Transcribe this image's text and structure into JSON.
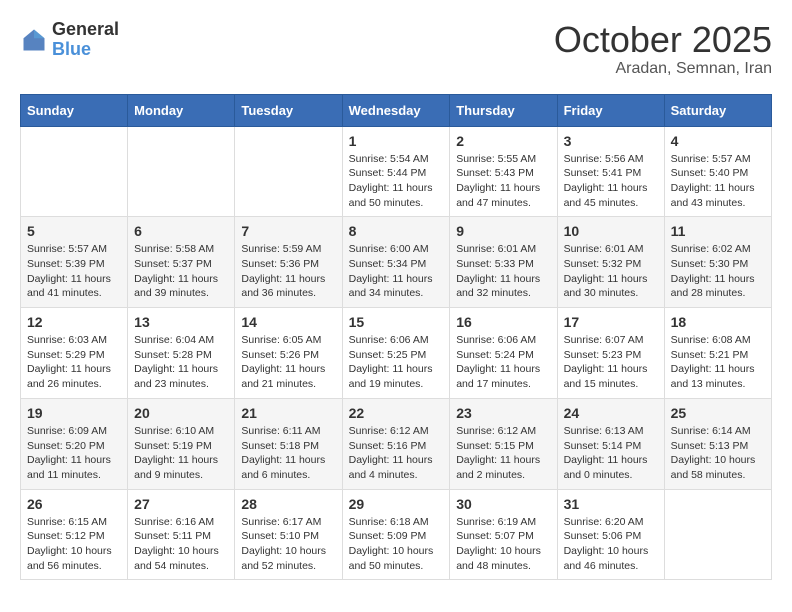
{
  "logo": {
    "general": "General",
    "blue": "Blue"
  },
  "header": {
    "month": "October 2025",
    "location": "Aradan, Semnan, Iran"
  },
  "weekdays": [
    "Sunday",
    "Monday",
    "Tuesday",
    "Wednesday",
    "Thursday",
    "Friday",
    "Saturday"
  ],
  "weeks": [
    [
      {
        "day": "",
        "info": ""
      },
      {
        "day": "",
        "info": ""
      },
      {
        "day": "",
        "info": ""
      },
      {
        "day": "1",
        "info": "Sunrise: 5:54 AM\nSunset: 5:44 PM\nDaylight: 11 hours\nand 50 minutes."
      },
      {
        "day": "2",
        "info": "Sunrise: 5:55 AM\nSunset: 5:43 PM\nDaylight: 11 hours\nand 47 minutes."
      },
      {
        "day": "3",
        "info": "Sunrise: 5:56 AM\nSunset: 5:41 PM\nDaylight: 11 hours\nand 45 minutes."
      },
      {
        "day": "4",
        "info": "Sunrise: 5:57 AM\nSunset: 5:40 PM\nDaylight: 11 hours\nand 43 minutes."
      }
    ],
    [
      {
        "day": "5",
        "info": "Sunrise: 5:57 AM\nSunset: 5:39 PM\nDaylight: 11 hours\nand 41 minutes."
      },
      {
        "day": "6",
        "info": "Sunrise: 5:58 AM\nSunset: 5:37 PM\nDaylight: 11 hours\nand 39 minutes."
      },
      {
        "day": "7",
        "info": "Sunrise: 5:59 AM\nSunset: 5:36 PM\nDaylight: 11 hours\nand 36 minutes."
      },
      {
        "day": "8",
        "info": "Sunrise: 6:00 AM\nSunset: 5:34 PM\nDaylight: 11 hours\nand 34 minutes."
      },
      {
        "day": "9",
        "info": "Sunrise: 6:01 AM\nSunset: 5:33 PM\nDaylight: 11 hours\nand 32 minutes."
      },
      {
        "day": "10",
        "info": "Sunrise: 6:01 AM\nSunset: 5:32 PM\nDaylight: 11 hours\nand 30 minutes."
      },
      {
        "day": "11",
        "info": "Sunrise: 6:02 AM\nSunset: 5:30 PM\nDaylight: 11 hours\nand 28 minutes."
      }
    ],
    [
      {
        "day": "12",
        "info": "Sunrise: 6:03 AM\nSunset: 5:29 PM\nDaylight: 11 hours\nand 26 minutes."
      },
      {
        "day": "13",
        "info": "Sunrise: 6:04 AM\nSunset: 5:28 PM\nDaylight: 11 hours\nand 23 minutes."
      },
      {
        "day": "14",
        "info": "Sunrise: 6:05 AM\nSunset: 5:26 PM\nDaylight: 11 hours\nand 21 minutes."
      },
      {
        "day": "15",
        "info": "Sunrise: 6:06 AM\nSunset: 5:25 PM\nDaylight: 11 hours\nand 19 minutes."
      },
      {
        "day": "16",
        "info": "Sunrise: 6:06 AM\nSunset: 5:24 PM\nDaylight: 11 hours\nand 17 minutes."
      },
      {
        "day": "17",
        "info": "Sunrise: 6:07 AM\nSunset: 5:23 PM\nDaylight: 11 hours\nand 15 minutes."
      },
      {
        "day": "18",
        "info": "Sunrise: 6:08 AM\nSunset: 5:21 PM\nDaylight: 11 hours\nand 13 minutes."
      }
    ],
    [
      {
        "day": "19",
        "info": "Sunrise: 6:09 AM\nSunset: 5:20 PM\nDaylight: 11 hours\nand 11 minutes."
      },
      {
        "day": "20",
        "info": "Sunrise: 6:10 AM\nSunset: 5:19 PM\nDaylight: 11 hours\nand 9 minutes."
      },
      {
        "day": "21",
        "info": "Sunrise: 6:11 AM\nSunset: 5:18 PM\nDaylight: 11 hours\nand 6 minutes."
      },
      {
        "day": "22",
        "info": "Sunrise: 6:12 AM\nSunset: 5:16 PM\nDaylight: 11 hours\nand 4 minutes."
      },
      {
        "day": "23",
        "info": "Sunrise: 6:12 AM\nSunset: 5:15 PM\nDaylight: 11 hours\nand 2 minutes."
      },
      {
        "day": "24",
        "info": "Sunrise: 6:13 AM\nSunset: 5:14 PM\nDaylight: 11 hours\nand 0 minutes."
      },
      {
        "day": "25",
        "info": "Sunrise: 6:14 AM\nSunset: 5:13 PM\nDaylight: 10 hours\nand 58 minutes."
      }
    ],
    [
      {
        "day": "26",
        "info": "Sunrise: 6:15 AM\nSunset: 5:12 PM\nDaylight: 10 hours\nand 56 minutes."
      },
      {
        "day": "27",
        "info": "Sunrise: 6:16 AM\nSunset: 5:11 PM\nDaylight: 10 hours\nand 54 minutes."
      },
      {
        "day": "28",
        "info": "Sunrise: 6:17 AM\nSunset: 5:10 PM\nDaylight: 10 hours\nand 52 minutes."
      },
      {
        "day": "29",
        "info": "Sunrise: 6:18 AM\nSunset: 5:09 PM\nDaylight: 10 hours\nand 50 minutes."
      },
      {
        "day": "30",
        "info": "Sunrise: 6:19 AM\nSunset: 5:07 PM\nDaylight: 10 hours\nand 48 minutes."
      },
      {
        "day": "31",
        "info": "Sunrise: 6:20 AM\nSunset: 5:06 PM\nDaylight: 10 hours\nand 46 minutes."
      },
      {
        "day": "",
        "info": ""
      }
    ]
  ]
}
